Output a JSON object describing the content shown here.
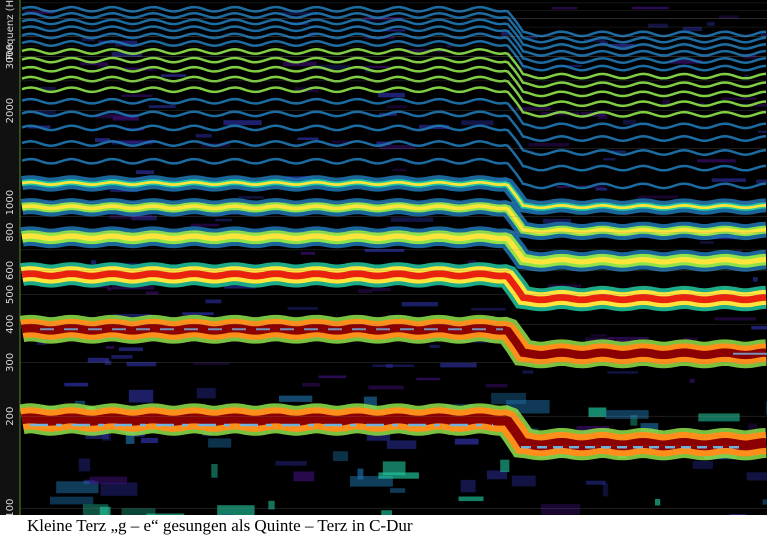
{
  "chart_data": {
    "type": "heatmap",
    "ylabel": "Frequenz (Hz)",
    "y_scale": "log",
    "ylim": [
      95,
      4600
    ],
    "y_ticks": [
      "100",
      "200",
      "300",
      "400",
      "500",
      "600",
      "800",
      "1000",
      "2000",
      "3000"
    ],
    "colormap": [
      "#000000",
      "#3b0f70",
      "#2c2fa0",
      "#1f78b4",
      "#21c8a0",
      "#8fe34a",
      "#ffe53b",
      "#ff8f1a",
      "#e8220e",
      "#8b0000"
    ],
    "grid": true,
    "transition": "abrupt pitch change approx. two thirds through the recording",
    "tracked_f0_hz": {
      "before": 190,
      "after": 162
    },
    "bands": [
      {
        "name": "fundamental",
        "before_hz": 195,
        "after_hz": 162,
        "level_before": 0.95,
        "level_after": 0.6
      },
      {
        "name": "harmonic 2",
        "before_hz": 385,
        "after_hz": 320,
        "level_before": 1.0,
        "level_after": 0.98
      },
      {
        "name": "harmonic 3",
        "before_hz": 580,
        "after_hz": 485,
        "level_before": 0.9,
        "level_after": 0.85
      },
      {
        "name": "harmonic 4",
        "before_hz": 770,
        "after_hz": 645,
        "level_before": 0.68,
        "level_after": 0.7
      },
      {
        "name": "harmonic 5",
        "before_hz": 965,
        "after_hz": 808,
        "level_before": 0.65,
        "level_after": 0.68
      },
      {
        "name": "harmonic 6",
        "before_hz": 1155,
        "after_hz": 970,
        "level_before": 0.48,
        "level_after": 0.62
      }
    ]
  },
  "caption": "Kleine Terz „g – e“ gesungen als Quinte – Terz in C-Dur"
}
